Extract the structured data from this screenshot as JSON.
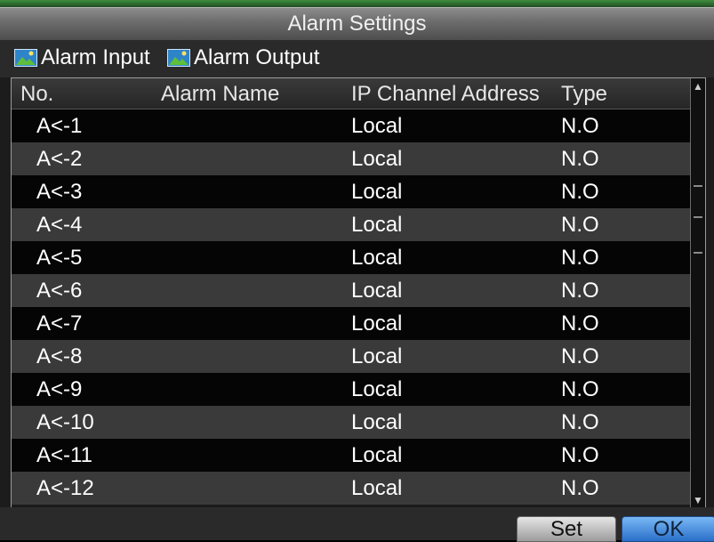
{
  "window": {
    "title": "Alarm Settings"
  },
  "tabs": [
    {
      "label": "Alarm Input",
      "icon": "picture-icon",
      "active": true
    },
    {
      "label": "Alarm Output",
      "icon": "picture-icon",
      "active": false
    }
  ],
  "table": {
    "columns": [
      "No.",
      "Alarm Name",
      "IP Channel Address",
      "Type"
    ],
    "rows": [
      {
        "no": "A<-1",
        "name": "",
        "ip": "Local",
        "type": "N.O"
      },
      {
        "no": "A<-2",
        "name": "",
        "ip": "Local",
        "type": "N.O"
      },
      {
        "no": "A<-3",
        "name": "",
        "ip": "Local",
        "type": "N.O"
      },
      {
        "no": "A<-4",
        "name": "",
        "ip": "Local",
        "type": "N.O"
      },
      {
        "no": "A<-5",
        "name": "",
        "ip": "Local",
        "type": "N.O"
      },
      {
        "no": "A<-6",
        "name": "",
        "ip": "Local",
        "type": "N.O"
      },
      {
        "no": "A<-7",
        "name": "",
        "ip": "Local",
        "type": "N.O"
      },
      {
        "no": "A<-8",
        "name": "",
        "ip": "Local",
        "type": "N.O"
      },
      {
        "no": "A<-9",
        "name": "",
        "ip": "Local",
        "type": "N.O"
      },
      {
        "no": "A<-10",
        "name": "",
        "ip": "Local",
        "type": "N.O"
      },
      {
        "no": "A<-11",
        "name": "",
        "ip": "Local",
        "type": "N.O"
      },
      {
        "no": "A<-12",
        "name": "",
        "ip": "Local",
        "type": "N.O"
      }
    ]
  },
  "footer": {
    "set_label": "Set",
    "ok_label": "OK"
  },
  "colors": {
    "accent": "#2a6fc9",
    "row_dark": "#050505",
    "row_light": "#3a3a3a"
  }
}
